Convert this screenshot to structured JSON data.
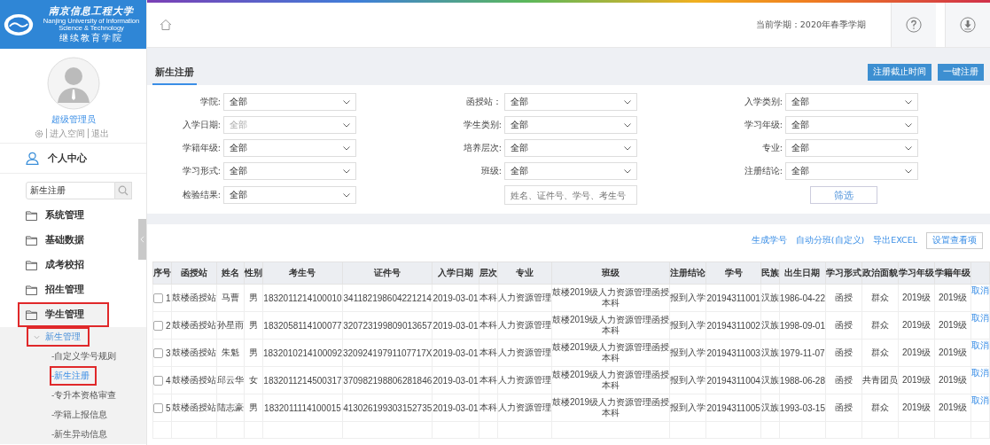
{
  "sidebar": {
    "logo": {
      "title": "南京信息工程大学",
      "subtitle_en": "Nanjing University of Information Science & Technology",
      "subtitle": "继续教育学院"
    },
    "user": {
      "name": "超级管理员",
      "links": [
        "进入空间",
        "退出"
      ]
    },
    "personal_center": "个人中心",
    "search": {
      "value": "新生注册"
    },
    "menu": [
      {
        "label": "系统管理",
        "selected": false,
        "expanded": false
      },
      {
        "label": "基础数据",
        "selected": false,
        "expanded": false
      },
      {
        "label": "成考校招",
        "selected": false,
        "expanded": false
      },
      {
        "label": "招生管理",
        "selected": false,
        "expanded": false
      },
      {
        "label": "学生管理",
        "selected": true,
        "expanded": true,
        "children": [
          {
            "label": "新生管理",
            "selected": true,
            "expanded": true,
            "children": [
              {
                "label": "-自定义学号规则",
                "selected": false
              },
              {
                "label": "-新生注册",
                "selected": true
              },
              {
                "label": "-专升本资格审查",
                "selected": false
              },
              {
                "label": "-学籍上报信息",
                "selected": false
              },
              {
                "label": "-新生异动信息",
                "selected": false
              }
            ]
          }
        ]
      }
    ]
  },
  "topbar": {
    "term": "当前学期：2020年春季学期"
  },
  "page": {
    "tab": "新生注册",
    "buttons": [
      "注册截止时间",
      "一键注册"
    ]
  },
  "filters": [
    {
      "label": "学院:",
      "value": "全部"
    },
    {
      "label": "函授站：",
      "value": "全部"
    },
    {
      "label": "入学类别:",
      "value": "全部"
    },
    {
      "label": "入学日期:",
      "placeholder": "全部"
    },
    {
      "label": "学生类别:",
      "value": "全部"
    },
    {
      "label": "学习年级:",
      "value": "全部"
    },
    {
      "label": "学籍年级:",
      "value": "全部"
    },
    {
      "label": "培养层次:",
      "value": "全部"
    },
    {
      "label": "专业:",
      "value": "全部"
    },
    {
      "label": "学习形式:",
      "value": "全部"
    },
    {
      "label": "班级:",
      "value": "全部"
    },
    {
      "label": "注册结论:",
      "value": "全部"
    },
    {
      "label": "检验结果:",
      "value": "全部"
    }
  ],
  "keyword": {
    "placeholder": "姓名、证件号、学号、考生号"
  },
  "filter_button": "筛选",
  "actions": {
    "links": [
      "生成学号",
      "自动分班(自定义)",
      "导出EXCEL"
    ],
    "button": "设置查看项"
  },
  "table": {
    "columns": [
      "序号",
      "函授站",
      "姓名",
      "性别",
      "考生号",
      "证件号",
      "入学日期",
      "层次",
      "专业",
      "班级",
      "注册结论",
      "学号",
      "民族",
      "出生日期",
      "学习形式",
      "政治面貌",
      "学习年级",
      "学籍年级"
    ],
    "rows": [
      {
        "checked": false,
        "cells": [
          "1",
          "鼓楼函授站",
          "马曹",
          "男",
          "1832011214100010",
          "341182198604221214",
          "2019-03-01",
          "本科",
          "人力资源管理",
          "鼓楼2019级人力资源管理函授本科",
          "报到入学",
          "20194311001",
          "汉族",
          "1986-04-22",
          "函授",
          "群众",
          "2019级",
          "2019级"
        ],
        "action": "取消"
      },
      {
        "checked": false,
        "cells": [
          "2",
          "鼓楼函授站",
          "孙星雨",
          "男",
          "1832058114100077",
          "320723199809013657",
          "2019-03-01",
          "本科",
          "人力资源管理",
          "鼓楼2019级人力资源管理函授本科",
          "报到入学",
          "20194311002",
          "汉族",
          "1998-09-01",
          "函授",
          "群众",
          "2019级",
          "2019级"
        ],
        "action": "取消"
      },
      {
        "checked": false,
        "cells": [
          "3",
          "鼓楼函授站",
          "朱魁",
          "男",
          "1832010214100092",
          "32092419791107717X",
          "2019-03-01",
          "本科",
          "人力资源管理",
          "鼓楼2019级人力资源管理函授本科",
          "报到入学",
          "20194311003",
          "汉族",
          "1979-11-07",
          "函授",
          "群众",
          "2019级",
          "2019级"
        ],
        "action": "取消"
      },
      {
        "checked": false,
        "cells": [
          "4",
          "鼓楼函授站",
          "邱云华",
          "女",
          "1832011214500317",
          "370982198806281846",
          "2019-03-01",
          "本科",
          "人力资源管理",
          "鼓楼2019级人力资源管理函授本科",
          "报到入学",
          "20194311004",
          "汉族",
          "1988-06-28",
          "函授",
          "共青团员",
          "2019级",
          "2019级"
        ],
        "action": "取消"
      },
      {
        "checked": false,
        "cells": [
          "5",
          "鼓楼函授站",
          "陆志豪",
          "男",
          "1832011114100015",
          "413026199303152735",
          "2019-03-01",
          "本科",
          "人力资源管理",
          "鼓楼2019级人力资源管理函授本科",
          "报到入学",
          "20194311005",
          "汉族",
          "1993-03-15",
          "函授",
          "群众",
          "2019级",
          "2019级"
        ],
        "action": "取消"
      }
    ]
  }
}
